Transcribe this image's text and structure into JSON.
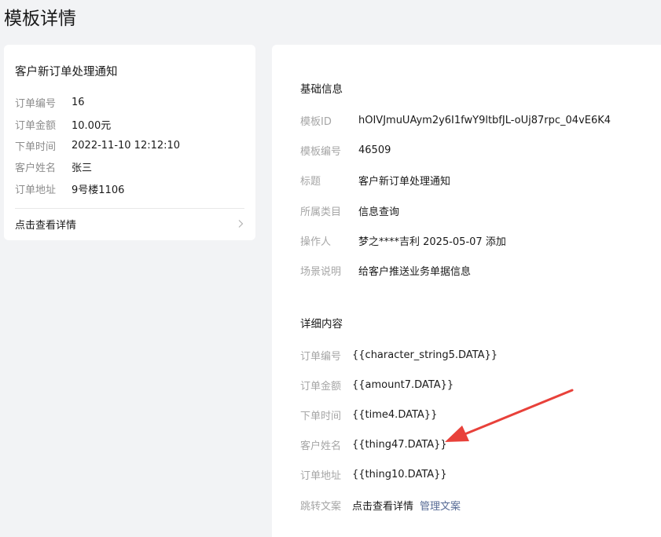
{
  "page": {
    "title": "模板详情"
  },
  "preview": {
    "title": "客户新订单处理通知",
    "rows": [
      {
        "label": "订单编号",
        "value": "16"
      },
      {
        "label": "订单金额",
        "value": "10.00元"
      },
      {
        "label": "下单时间",
        "value": "2022-11-10 12:12:10"
      },
      {
        "label": "客户姓名",
        "value": "张三"
      },
      {
        "label": "订单地址",
        "value": "9号楼1106"
      }
    ],
    "link_label": "点击查看详情"
  },
  "basic": {
    "heading": "基础信息",
    "rows": [
      {
        "label": "模板ID",
        "value": "hOIVJmuUAym2y6I1fwY9ltbfJL-oUj87rpc_04vE6K4"
      },
      {
        "label": "模板编号",
        "value": "46509"
      },
      {
        "label": "标题",
        "value": "客户新订单处理通知"
      },
      {
        "label": "所属类目",
        "value": "信息查询"
      },
      {
        "label": "操作人",
        "value": "梦之****吉利 2025-05-07 添加"
      },
      {
        "label": "场景说明",
        "value": "给客户推送业务单据信息"
      }
    ]
  },
  "detail": {
    "heading": "详细内容",
    "rows": [
      {
        "label": "订单编号",
        "value": "{{character_string5.DATA}}"
      },
      {
        "label": "订单金额",
        "value": "{{amount7.DATA}}"
      },
      {
        "label": "下单时间",
        "value": "{{time4.DATA}}"
      },
      {
        "label": "客户姓名",
        "value": "{{thing47.DATA}}"
      },
      {
        "label": "订单地址",
        "value": "{{thing10.DATA}}"
      }
    ],
    "jump": {
      "label": "跳转文案",
      "value": "点击查看详情",
      "manage_link": "管理文案"
    }
  },
  "colors": {
    "link": "#576b95",
    "annotation_arrow": "#e8413a"
  },
  "icons": {
    "preview_link": "chevron-right-icon",
    "annotation": "red-arrow-icon"
  }
}
